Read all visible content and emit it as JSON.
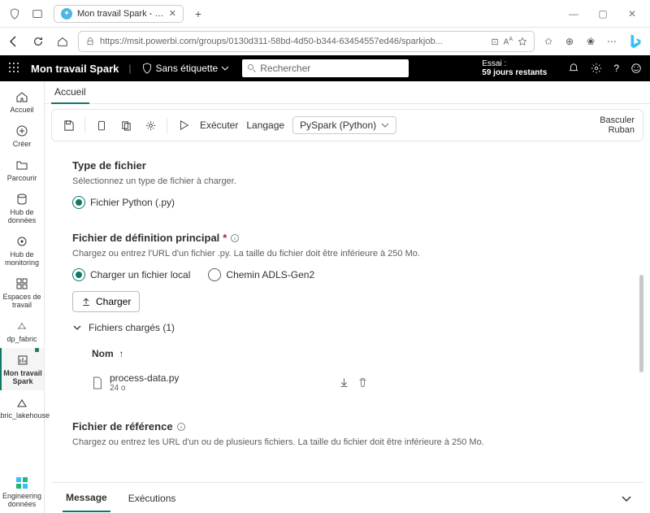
{
  "browser": {
    "tab_title": "Mon travail Spark - Ingénieur d",
    "url": "https://msit.powerbi.com/groups/0130d311-58bd-4d50-b344-63454557ed46/sparkjob..."
  },
  "topbar": {
    "workspace": "Mon travail Spark",
    "sensitivity": "Sans étiquette",
    "search_ph": "Rechercher",
    "trial_label": "Essai :",
    "trial_remaining": "59 jours restants"
  },
  "sidebar": {
    "items": [
      {
        "label": "Accueil"
      },
      {
        "label": "Créer"
      },
      {
        "label": "Parcourir"
      },
      {
        "label": "Hub de données"
      },
      {
        "label": "Hub de monitoring"
      },
      {
        "label": "Espaces de travail"
      },
      {
        "label": "dp_fabric"
      },
      {
        "label": "Mon travail Spark"
      },
      {
        "label": "fabric_lakehouse"
      }
    ],
    "bottom": {
      "label": "Engineering données"
    }
  },
  "page_tabs": {
    "home": "Accueil"
  },
  "toolbar": {
    "run": "Exécuter",
    "language_label": "Langage",
    "language_value": "PySpark (Python)",
    "right1": "Basculer",
    "right2": "Ruban"
  },
  "form": {
    "file_type": {
      "title": "Type de fichier",
      "desc": "Sélectionnez un type de fichier à charger.",
      "opt1": "Fichier Python (.py)"
    },
    "main_def": {
      "title": "Fichier de définition principal",
      "desc": "Chargez ou entrez l'URL d'un fichier .py. La taille du fichier doit être inférieure à 250 Mo.",
      "opt_local": "Charger un fichier local",
      "opt_adls": "Chemin ADLS-Gen2",
      "upload_btn": "Charger",
      "loaded_label": "Fichiers chargés (1)",
      "col_name": "Nom",
      "files": [
        {
          "name": "process-data.py",
          "size": "24 o"
        }
      ]
    },
    "reference": {
      "title": "Fichier de référence",
      "desc": "Chargez ou entrez les URL d'un ou de plusieurs fichiers. La taille du fichier doit être inférieure à 250 Mo."
    }
  },
  "bottom_panel": {
    "tab1": "Message",
    "tab2": "Exécutions"
  }
}
